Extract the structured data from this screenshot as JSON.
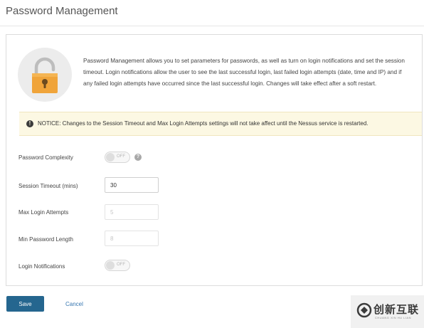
{
  "page": {
    "title": "Password Management"
  },
  "intro": {
    "icon": "padlock-icon",
    "text": "Password Management allows you to set parameters for passwords, as well as turn on login notifications and set the session timeout. Login notifications allow the user to see the last successful login, last failed login attempts (date, time and IP) and if any failed login attempts have occurred since the last successful login. Changes will take effect after a soft restart."
  },
  "notice": {
    "icon": "exclamation-circle-icon",
    "text": "NOTICE: Changes to the Session Timeout and Max Login Attempts settings will not take affect until the Nessus service is restarted.",
    "background": "#fcf8e3"
  },
  "form": {
    "password_complexity": {
      "label": "Password Complexity",
      "state": "OFF"
    },
    "session_timeout": {
      "label": "Session Timeout (mins)",
      "value": "30"
    },
    "max_login_attempts": {
      "label": "Max Login Attempts",
      "placeholder": "5"
    },
    "min_password_length": {
      "label": "Min Password Length",
      "placeholder": "8"
    },
    "login_notifications": {
      "label": "Login Notifications",
      "state": "OFF"
    }
  },
  "actions": {
    "save_label": "Save",
    "cancel_label": "Cancel",
    "primary_color": "#25668f"
  },
  "watermark": {
    "name": "创新互联",
    "subtitle": "CHUANG XIN HU LIAN"
  }
}
